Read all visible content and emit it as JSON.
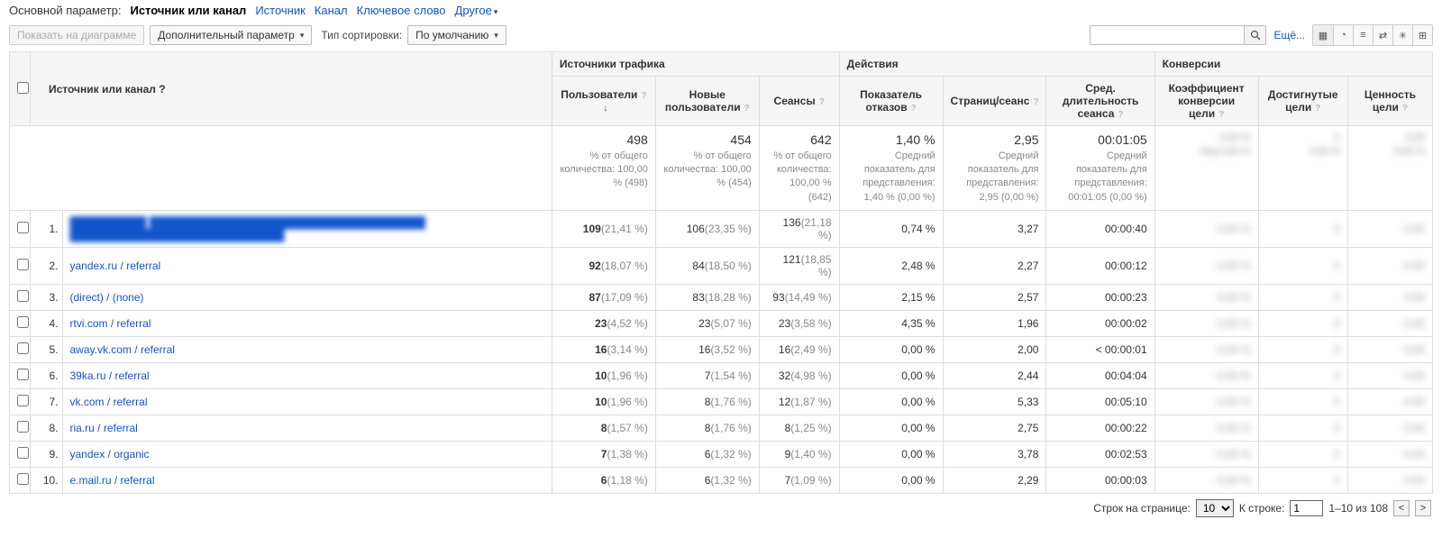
{
  "primaryDim": {
    "label": "Основной параметр:",
    "active": "Источник или канал",
    "links": [
      "Источник",
      "Канал",
      "Ключевое слово",
      "Другое"
    ]
  },
  "toolbar": {
    "plotBtn": "Показать на диаграмме",
    "secondaryDim": "Дополнительный параметр",
    "sortLabel": "Тип сортировки:",
    "sortValue": "По умолчанию",
    "more": "Ещё..."
  },
  "headers": {
    "col0": "Источник или канал",
    "group1": "Источники трафика",
    "group2": "Действия",
    "group3": "Конверсии",
    "users": "Пользователи",
    "newUsers": "Новые пользователи",
    "sessions": "Сеансы",
    "bounce": "Показатель отказов",
    "pages": "Страниц/сеанс",
    "duration": "Сред. длительность сеанса",
    "convRate": "Коэффициент конверсии цели",
    "goals": "Достигнутые цели",
    "value": "Ценность цели"
  },
  "summary": {
    "users": {
      "v": "498",
      "sub": "% от общего количества: 100,00 % (498)"
    },
    "newUsers": {
      "v": "454",
      "sub": "% от общего количества: 100,00 % (454)"
    },
    "sessions": {
      "v": "642",
      "sub": "% от общего количества: 100,00 % (642)"
    },
    "bounce": {
      "v": "1,40 %",
      "sub": "Средний показатель для представления: 1,40 % (0,00 %)"
    },
    "pages": {
      "v": "2,95",
      "sub": "Средний показатель для представления: 2,95 (0,00 %)"
    },
    "duration": {
      "v": "00:01:05",
      "sub": "Средний показатель для представления: 00:01:05 (0,00 %)"
    }
  },
  "rows": [
    {
      "idx": "1.",
      "src": "██████████ ████████████████████████████████████ ████████████████████████████",
      "blurSrc": true,
      "users": "109",
      "usersP": "(21,41 %)",
      "nu": "106",
      "nuP": "(23,35 %)",
      "sess": "136",
      "sessP": "(21,18 %)",
      "bounce": "0,74 %",
      "pages": "3,27",
      "dur": "00:00:40"
    },
    {
      "idx": "2.",
      "src": "yandex.ru / referral",
      "users": "92",
      "usersP": "(18,07 %)",
      "nu": "84",
      "nuP": "(18,50 %)",
      "sess": "121",
      "sessP": "(18,85 %)",
      "bounce": "2,48 %",
      "pages": "2,27",
      "dur": "00:00:12"
    },
    {
      "idx": "3.",
      "src": "(direct) / (none)",
      "users": "87",
      "usersP": "(17,09 %)",
      "nu": "83",
      "nuP": "(18,28 %)",
      "sess": "93",
      "sessP": "(14,49 %)",
      "bounce": "2,15 %",
      "pages": "2,57",
      "dur": "00:00:23"
    },
    {
      "idx": "4.",
      "src": "rtvi.com / referral",
      "users": "23",
      "usersP": "(4,52 %)",
      "nu": "23",
      "nuP": "(5,07 %)",
      "sess": "23",
      "sessP": "(3,58 %)",
      "bounce": "4,35 %",
      "pages": "1,96",
      "dur": "00:00:02"
    },
    {
      "idx": "5.",
      "src": "away.vk.com / referral",
      "users": "16",
      "usersP": "(3,14 %)",
      "nu": "16",
      "nuP": "(3,52 %)",
      "sess": "16",
      "sessP": "(2,49 %)",
      "bounce": "0,00 %",
      "pages": "2,00",
      "dur": "< 00:00:01"
    },
    {
      "idx": "6.",
      "src": "39ka.ru / referral",
      "users": "10",
      "usersP": "(1,96 %)",
      "nu": "7",
      "nuP": "(1,54 %)",
      "sess": "32",
      "sessP": "(4,98 %)",
      "bounce": "0,00 %",
      "pages": "2,44",
      "dur": "00:04:04"
    },
    {
      "idx": "7.",
      "src": "vk.com / referral",
      "users": "10",
      "usersP": "(1,96 %)",
      "nu": "8",
      "nuP": "(1,76 %)",
      "sess": "12",
      "sessP": "(1,87 %)",
      "bounce": "0,00 %",
      "pages": "5,33",
      "dur": "00:05:10"
    },
    {
      "idx": "8.",
      "src": "ria.ru / referral",
      "users": "8",
      "usersP": "(1,57 %)",
      "nu": "8",
      "nuP": "(1,76 %)",
      "sess": "8",
      "sessP": "(1,25 %)",
      "bounce": "0,00 %",
      "pages": "2,75",
      "dur": "00:00:22"
    },
    {
      "idx": "9.",
      "src": "yandex / organic",
      "users": "7",
      "usersP": "(1,38 %)",
      "nu": "6",
      "nuP": "(1,32 %)",
      "sess": "9",
      "sessP": "(1,40 %)",
      "bounce": "0,00 %",
      "pages": "3,78",
      "dur": "00:02:53"
    },
    {
      "idx": "10.",
      "src": "e.mail.ru / referral",
      "users": "6",
      "usersP": "(1,18 %)",
      "nu": "6",
      "nuP": "(1,32 %)",
      "sess": "7",
      "sessP": "(1,09 %)",
      "bounce": "0,00 %",
      "pages": "2,29",
      "dur": "00:00:03"
    }
  ],
  "pager": {
    "rowsLabel": "Строк на странице:",
    "rows": "10",
    "gotoLabel": "К строке:",
    "gotoVal": "1",
    "range": "1–10 из 108"
  }
}
